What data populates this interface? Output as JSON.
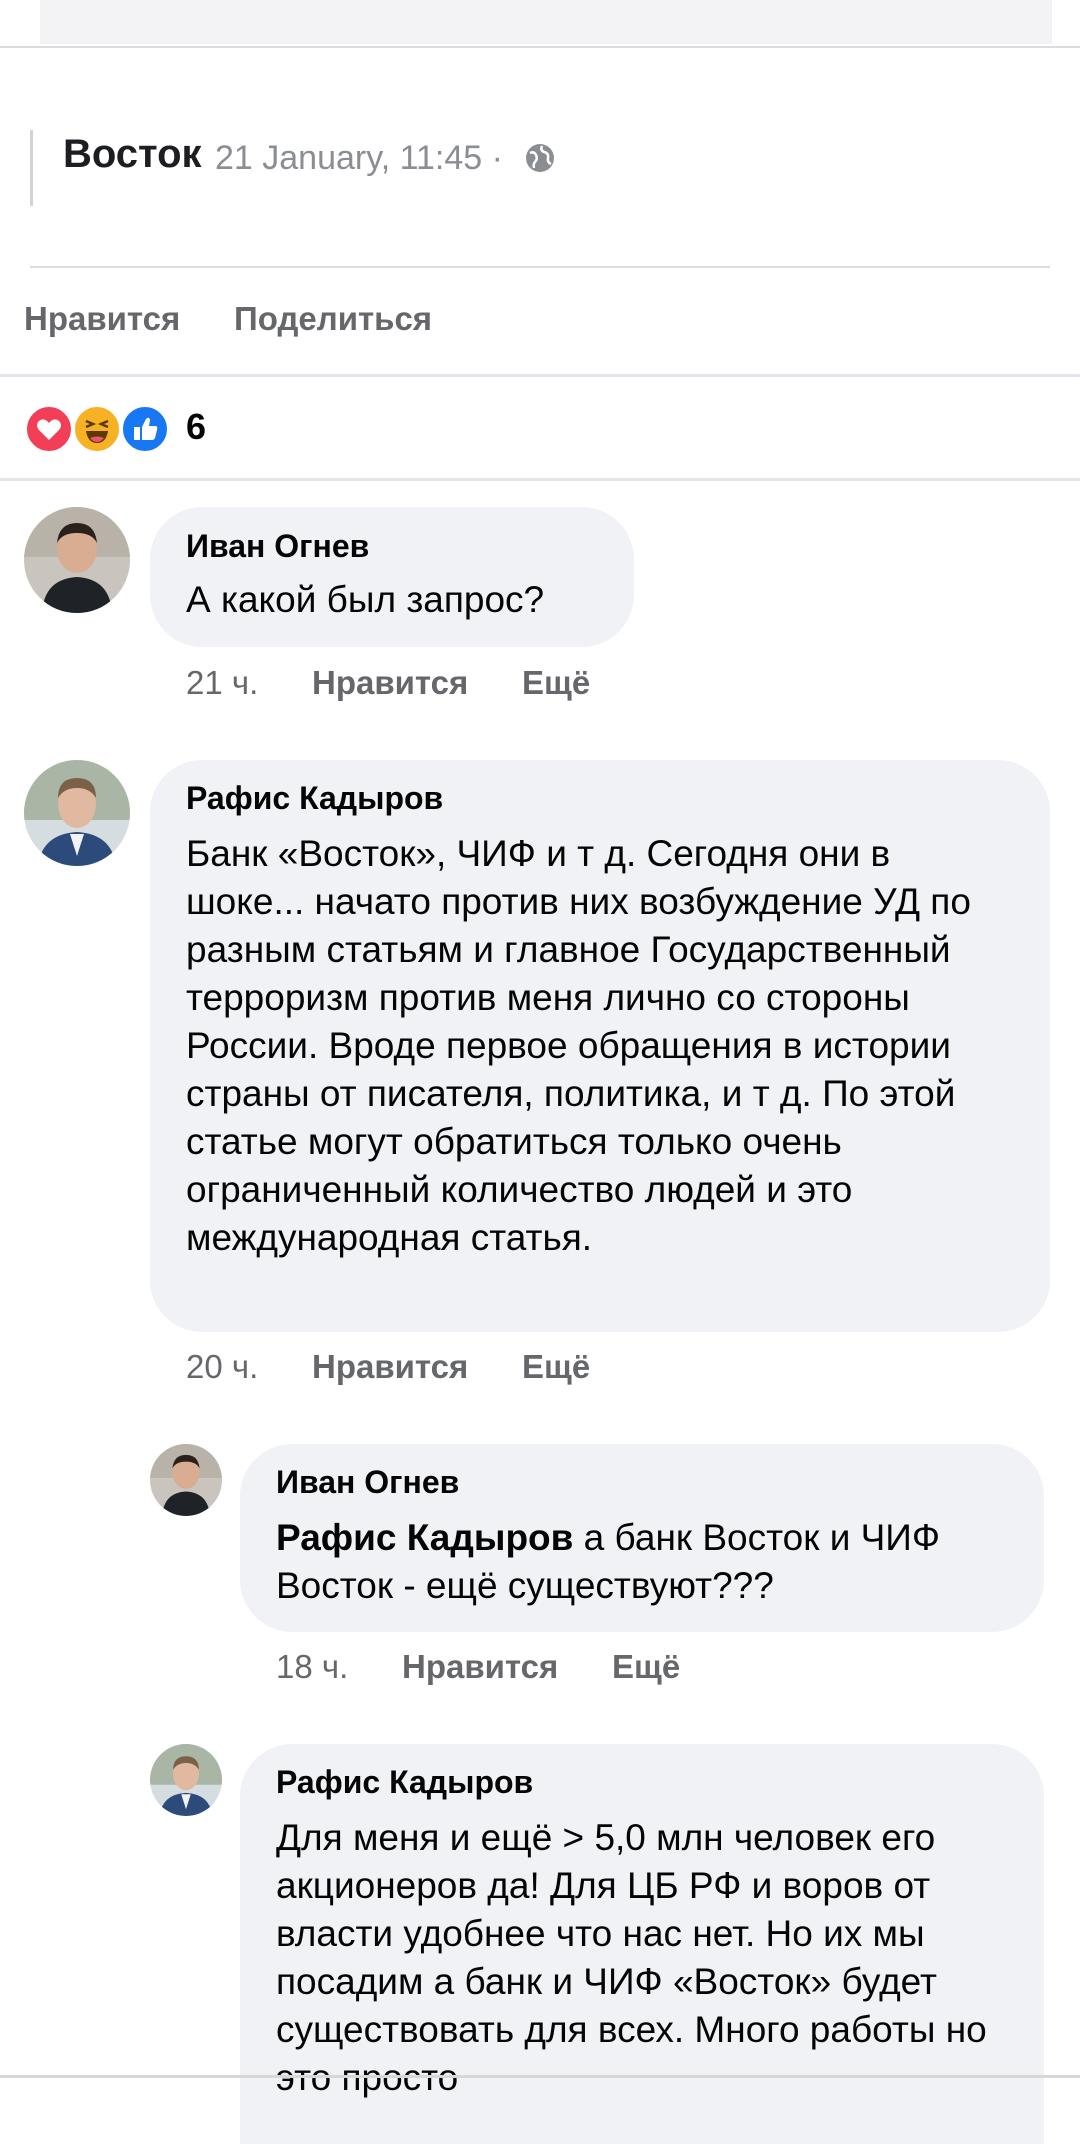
{
  "post": {
    "source_name": "Восток",
    "source_meta": "21 January, 11:45 ·",
    "actions": {
      "like": "Нравится",
      "share": "Поделиться"
    },
    "reaction_count": "6",
    "reaction_icons": [
      "heart-icon",
      "haha-icon",
      "like-icon"
    ]
  },
  "comments": [
    {
      "author": "Иван Огнев",
      "text": "А какой был запрос?",
      "time": "21 ч.",
      "like": "Нравится",
      "more": "Ещё"
    },
    {
      "author": "Рафис Кадыров",
      "text": "Банк «Восток», ЧИФ и т д. Сегодня они в шоке... начато против них возбуждение УД по разным статьям и главное Государственный терроризм против меня лично со стороны России. Вроде первое обращения в истории страны от писателя, политика, и т д. По этой статье могут обратиться только очень ограниченный количество людей и это международная статья.",
      "time": "20 ч.",
      "like": "Нравится",
      "more": "Ещё"
    },
    {
      "author": "Иван Огнев",
      "mention": "Рафис Кадыров",
      "text": " а банк Восток и ЧИФ Восток - ещё существуют???",
      "time": "18 ч.",
      "like": "Нравится",
      "more": "Ещё"
    },
    {
      "author": "Рафис Кадыров",
      "text": "Для меня и ещё > 5,0 млн человек его акционеров да! Для ЦБ РФ и воров от власти удобнее что нас нет. Но их мы посадим а банк и ЧИФ «Восток» будет существовать для всех. Много работы но это просто"
    }
  ],
  "colors": {
    "bubble": "#f0f2f5",
    "meta_text": "#65676b",
    "like_blue": "#1877f2",
    "love_red": "#f33e58",
    "haha_yellow": "#f7b125"
  }
}
